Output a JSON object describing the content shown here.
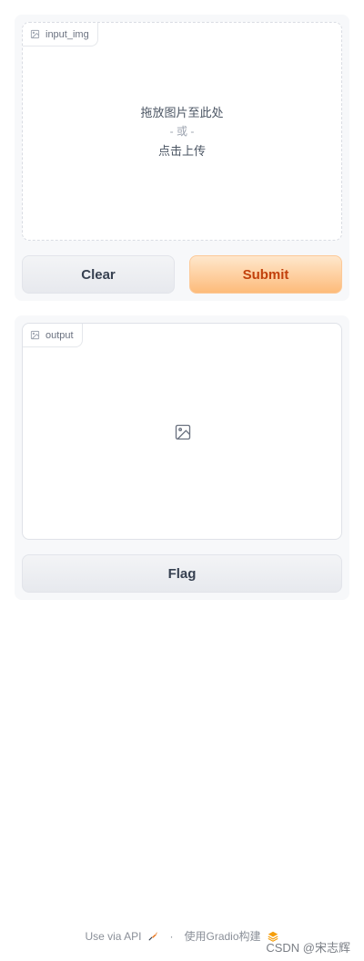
{
  "input": {
    "label": "input_img",
    "drop_prompt": "拖放图片至此处",
    "or_text": "- 或 -",
    "click_upload": "点击上传"
  },
  "actions": {
    "clear_label": "Clear",
    "submit_label": "Submit"
  },
  "output": {
    "label": "output"
  },
  "flag": {
    "label": "Flag"
  },
  "footer": {
    "api_text": "Use via API",
    "separator": "·",
    "built_with": "使用Gradio构建"
  },
  "watermark": "CSDN @宋志辉",
  "colors": {
    "primary_text": "#c2410c",
    "primary_bg_top": "#fee7cc",
    "primary_bg_bottom": "#fdbb7a",
    "api_icon": "#e8771f",
    "gradio_logo": "#f59e0b"
  },
  "icons": {
    "label_icon": "image-icon",
    "output_placeholder_icon": "image-icon",
    "api_icon": "rocket-icon",
    "gradio_icon": "gradio-logo-icon"
  }
}
